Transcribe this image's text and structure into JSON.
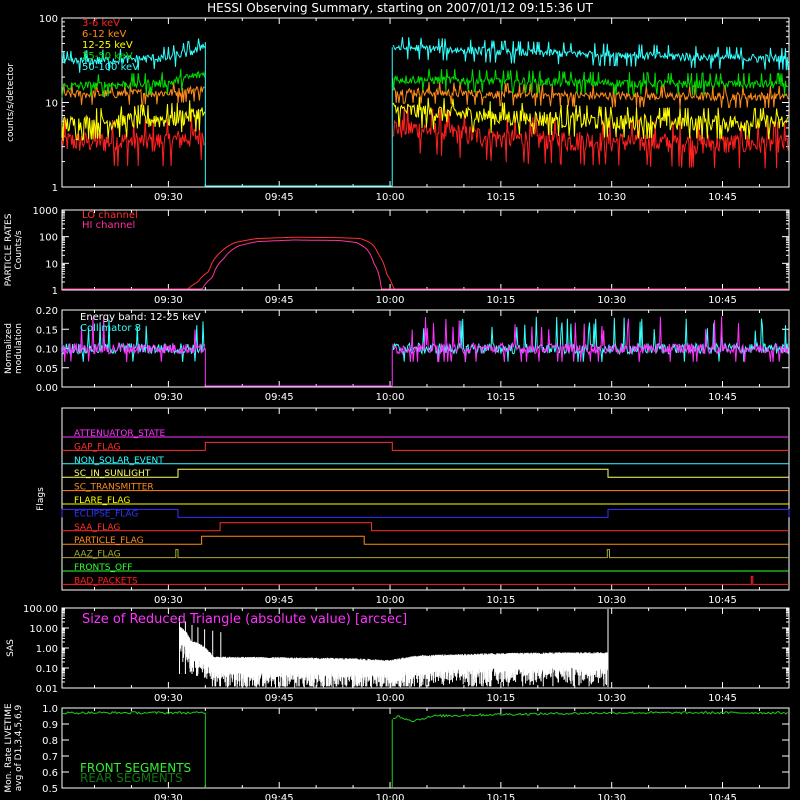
{
  "page": {
    "title": "HESSI Observing Summary, starting on 2007/01/12 09:15:36 UT"
  },
  "time_axis": {
    "start_min": 15.6,
    "end_min": 114.0,
    "ticks": [
      {
        "t": 30,
        "label": "09:30"
      },
      {
        "t": 45,
        "label": "09:45"
      },
      {
        "t": 60,
        "label": "10:00"
      },
      {
        "t": 75,
        "label": "10:15"
      },
      {
        "t": 90,
        "label": "10:30"
      },
      {
        "t": 105,
        "label": "10:45"
      }
    ]
  },
  "colors": {
    "axis": "#ffffff",
    "ch_3_6": "#ff2020",
    "ch_6_12": "#ff8c1a",
    "ch_12_25": "#ffff00",
    "ch_25_50": "#00dd00",
    "ch_50_100": "#33ffff",
    "lo_channel": "#ff3030",
    "hi_channel": "#ff3399",
    "collimator": "#33ffff",
    "modulation": "#ff33ff",
    "livetime": "#22cc22"
  },
  "chart_data": [
    {
      "id": "count_rates",
      "type": "line",
      "ylabel": "counts/s/detector",
      "yscale": "log",
      "ylim": [
        1,
        100
      ],
      "yticks": [
        {
          "v": 1,
          "label": "1"
        },
        {
          "v": 10,
          "label": "10"
        },
        {
          "v": 100,
          "label": "100"
        }
      ],
      "legend_position": "top-left",
      "gap_minutes": [
        35.0,
        60.3
      ],
      "series": [
        {
          "name": "3-6 keV",
          "color_key": "ch_3_6",
          "points": [
            [
              15.6,
              3.5
            ],
            [
              30,
              3.5
            ],
            [
              35.0,
              4.2
            ],
            [
              60.3,
              5.2
            ],
            [
              75,
              3.8
            ],
            [
              90,
              3.5
            ],
            [
              105,
              3.3
            ],
            [
              114,
              3.3
            ]
          ]
        },
        {
          "name": "6-12 keV",
          "color_key": "ch_6_12",
          "points": [
            [
              15.6,
              12.5
            ],
            [
              30,
              13.0
            ],
            [
              35.0,
              14.5
            ],
            [
              60.3,
              13.5
            ],
            [
              75,
              12.5
            ],
            [
              90,
              12.0
            ],
            [
              105,
              11.8
            ],
            [
              114,
              11.8
            ]
          ]
        },
        {
          "name": "12-25 keV",
          "color_key": "ch_12_25",
          "points": [
            [
              15.6,
              5.5
            ],
            [
              30,
              6.5
            ],
            [
              35.0,
              7.5
            ],
            [
              60.3,
              8.2
            ],
            [
              75,
              6.8
            ],
            [
              90,
              6.0
            ],
            [
              105,
              5.8
            ],
            [
              114,
              5.8
            ]
          ]
        },
        {
          "name": "25-50 keV",
          "color_key": "ch_25_50",
          "points": [
            [
              15.6,
              15.5
            ],
            [
              30,
              17.0
            ],
            [
              35.0,
              22.0
            ],
            [
              60.3,
              19.0
            ],
            [
              75,
              18.0
            ],
            [
              90,
              17.0
            ],
            [
              105,
              16.5
            ],
            [
              114,
              16.5
            ]
          ]
        },
        {
          "name": "50-100 keV",
          "color_key": "ch_50_100",
          "points": [
            [
              15.6,
              30
            ],
            [
              30,
              34
            ],
            [
              34.0,
              42
            ],
            [
              35.0,
              52
            ],
            [
              60.3,
              45
            ],
            [
              75,
              40
            ],
            [
              90,
              37
            ],
            [
              105,
              34
            ],
            [
              114,
              33
            ]
          ]
        }
      ]
    },
    {
      "id": "particle_rates",
      "type": "line",
      "ylabel": "PARTICLE RATES\nCounts/s",
      "yscale": "log",
      "ylim": [
        1,
        1000
      ],
      "yticks": [
        {
          "v": 1,
          "label": "1"
        },
        {
          "v": 10,
          "label": "10"
        },
        {
          "v": 100,
          "label": "100"
        },
        {
          "v": 1000,
          "label": "1000"
        }
      ],
      "legend_position": "top-left",
      "series": [
        {
          "name": "LO channel",
          "color_key": "lo_channel",
          "points": [
            [
              15.6,
              1
            ],
            [
              32.5,
              1
            ],
            [
              34,
              2
            ],
            [
              35.5,
              5
            ],
            [
              37,
              25
            ],
            [
              39,
              60
            ],
            [
              42,
              85
            ],
            [
              47,
              95
            ],
            [
              53,
              92
            ],
            [
              56,
              85
            ],
            [
              57.5,
              55
            ],
            [
              58.5,
              20
            ],
            [
              59.5,
              4
            ],
            [
              60.5,
              1
            ],
            [
              114,
              1
            ]
          ]
        },
        {
          "name": "HI channel",
          "color_key": "hi_channel",
          "points": [
            [
              15.6,
              1
            ],
            [
              34.5,
              1
            ],
            [
              36,
              3
            ],
            [
              37.5,
              15
            ],
            [
              39.5,
              45
            ],
            [
              42,
              65
            ],
            [
              47,
              75
            ],
            [
              53,
              72
            ],
            [
              55.5,
              60
            ],
            [
              56.8,
              35
            ],
            [
              57.8,
              10
            ],
            [
              58.8,
              1
            ],
            [
              114,
              1
            ]
          ]
        }
      ]
    },
    {
      "id": "modulation",
      "type": "line",
      "ylabel": "Normalized\nmodulation",
      "ylim": [
        0,
        0.2
      ],
      "yticks": [
        {
          "v": 0.0,
          "label": "0.00"
        },
        {
          "v": 0.05,
          "label": "0.05"
        },
        {
          "v": 0.1,
          "label": "0.10"
        },
        {
          "v": 0.15,
          "label": "0.15"
        },
        {
          "v": 0.2,
          "label": "0.20"
        }
      ],
      "legend_position": "top-left",
      "gap_minutes": [
        35.0,
        60.3
      ],
      "annotation": "Energy band: 12-25 keV",
      "series": [
        {
          "name": "Collimator 8",
          "color_key": "collimator",
          "level": 0.1
        },
        {
          "name": "Normalized modulation",
          "color_key": "modulation",
          "level": 0.1
        }
      ]
    },
    {
      "id": "flags",
      "type": "line",
      "ylabel": "Flags",
      "series": [
        {
          "name": "ATTENUATOR_STATE",
          "color": "#ff33ff",
          "segments": []
        },
        {
          "name": "GAP_FLAG",
          "color": "#ff3030",
          "segments": [
            [
              35.0,
              60.3
            ]
          ]
        },
        {
          "name": "NON_SOLAR_EVENT",
          "color": "#33ffff",
          "segments": []
        },
        {
          "name": "SC_IN_SUNLIGHT",
          "color": "#ffff66",
          "segments": [
            [
              31.3,
              89.5
            ]
          ]
        },
        {
          "name": "SC_TRANSMITTER",
          "color": "#ff8c1a",
          "segments": []
        },
        {
          "name": "FLARE_FLAG",
          "color": "#ffff00",
          "segments": []
        },
        {
          "name": "ECLIPSE_FLAG",
          "color": "#3333ff",
          "segments": [
            [
              15.6,
              31.3
            ],
            [
              89.5,
              114
            ]
          ]
        },
        {
          "name": "SAA_FLAG",
          "color": "#ff3030",
          "segments": [
            [
              37.0,
              57.5
            ]
          ]
        },
        {
          "name": "PARTICLE_FLAG",
          "color": "#ff8c1a",
          "segments": [
            [
              34.5,
              56.5
            ]
          ]
        },
        {
          "name": "AAZ_FLAG",
          "color": "#aaaa33",
          "segments": [
            [
              31.0,
              31.3
            ],
            [
              89.4,
              89.7
            ]
          ]
        },
        {
          "name": "FRONTS_OFF",
          "color": "#33ff33",
          "segments": []
        },
        {
          "name": "BAD_PACKETS",
          "color": "#ff2020",
          "segments": [
            [
              108.9,
              109.1
            ]
          ]
        }
      ]
    },
    {
      "id": "sas",
      "type": "line",
      "ylabel": "SAS",
      "yscale": "log",
      "ylim": [
        0.01,
        100
      ],
      "yticks": [
        {
          "v": 0.01,
          "label": "0.01"
        },
        {
          "v": 0.1,
          "label": "0.10"
        },
        {
          "v": 1,
          "label": "1.00"
        },
        {
          "v": 10,
          "label": "10.00"
        },
        {
          "v": 100,
          "label": "100.00"
        }
      ],
      "annotation": "Size of Reduced Triangle (absolute value) [arcsec]",
      "series": [
        {
          "name": "SAS",
          "color": "#ffffff",
          "points": [
            [
              31.5,
              10
            ],
            [
              33,
              2
            ],
            [
              36,
              0.3
            ],
            [
              45,
              0.28
            ],
            [
              55,
              0.25
            ],
            [
              60,
              0.2
            ],
            [
              64,
              0.35
            ],
            [
              75,
              0.45
            ],
            [
              85,
              0.5
            ],
            [
              89.5,
              0.5
            ]
          ]
        }
      ]
    },
    {
      "id": "livetime",
      "type": "line",
      "ylabel": "Mon. Rate LIVETIME\navg of D1,3,4,5,6,9",
      "ylim": [
        0.5,
        1.0
      ],
      "yticks": [
        {
          "v": 0.5,
          "label": "0.5"
        },
        {
          "v": 0.6,
          "label": "0.6"
        },
        {
          "v": 0.7,
          "label": "0.7"
        },
        {
          "v": 0.8,
          "label": "0.8"
        },
        {
          "v": 0.9,
          "label": "0.9"
        },
        {
          "v": 1.0,
          "label": "1.0"
        }
      ],
      "legend_position": "bottom-left",
      "gap_minutes": [
        35.0,
        60.3
      ],
      "series": [
        {
          "name": "FRONT SEGMENTS",
          "color_key": "livetime",
          "points": [
            [
              15.6,
              0.97
            ],
            [
              35.0,
              0.97
            ],
            [
              60.3,
              0.93
            ],
            [
              61,
              0.95
            ],
            [
              63,
              0.92
            ],
            [
              66,
              0.95
            ],
            [
              75,
              0.96
            ],
            [
              90,
              0.97
            ],
            [
              114,
              0.97
            ]
          ]
        },
        {
          "name": "REAR SEGMENTS",
          "color": "#117711",
          "points": []
        }
      ]
    }
  ]
}
